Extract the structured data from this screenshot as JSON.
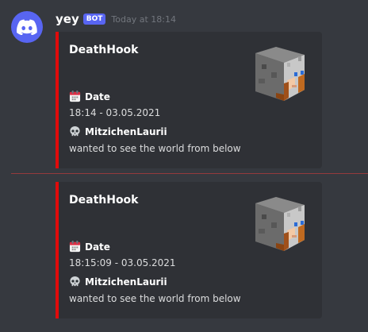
{
  "message": {
    "author": "yey",
    "bot_tag": "BOT",
    "timestamp": "Today at 18:14"
  },
  "embeds": [
    {
      "title": "DeathHook",
      "date_label": "Date",
      "date_value": "18:14 - 03.05.2021",
      "player_name": "MitzichenLaurii",
      "death_message": "wanted to see the world from below"
    },
    {
      "title": "DeathHook",
      "date_label": "Date",
      "date_value": "18:15:09 - 03.05.2021",
      "player_name": "MitzichenLaurii",
      "death_message": "wanted to see the world from below"
    }
  ],
  "colors": {
    "embed_accent": "#e10b0b",
    "blurple": "#5865f2",
    "background": "#36393f",
    "embed_background": "#2f3136"
  },
  "icons": [
    "discord-logo-icon",
    "calendar-icon",
    "skull-icon",
    "player-head-thumbnail"
  ]
}
